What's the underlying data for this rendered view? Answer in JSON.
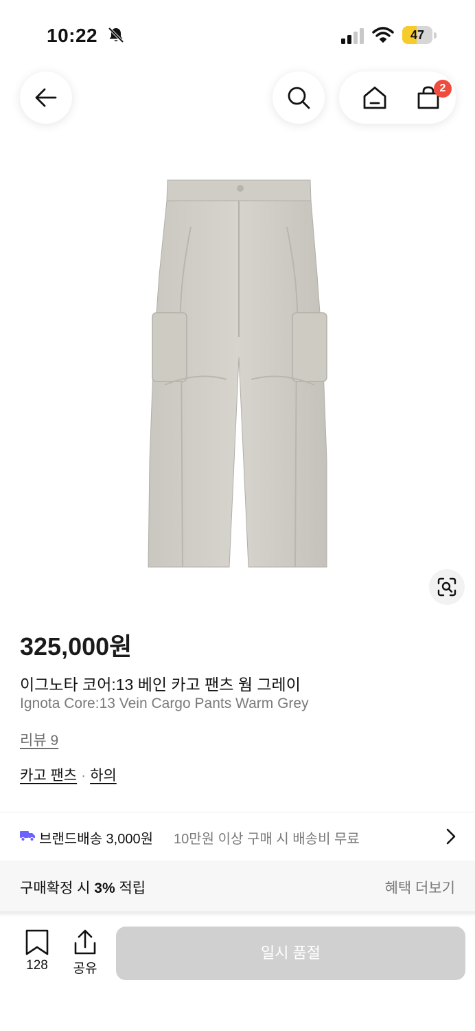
{
  "status_bar": {
    "time": "10:22",
    "battery": "47",
    "battery_level": 0.47,
    "icons": [
      "bell-slash-icon",
      "signal-icon",
      "wifi-icon",
      "battery-icon"
    ]
  },
  "nav": {
    "icons": [
      "back-arrow-icon",
      "search-icon",
      "home-icon",
      "shopping-bag-icon"
    ],
    "cart_badge": "2"
  },
  "product": {
    "image": "grey-cargo-pants",
    "price": "325,000원",
    "name_ko": "이그노타 코어:13 베인 카고 팬츠 웜 그레이",
    "name_en": "Ignota Core:13 Vein Cargo Pants Warm Grey",
    "review": "리뷰 9",
    "category_1": "카고 팬츠",
    "category_sep": "·",
    "category_2": "하의"
  },
  "shipping": {
    "main": "브랜드배송 3,000원",
    "sub": "10만원 이상 구매 시 배송비 무료"
  },
  "benefit": {
    "prefix": "구매확정 시 ",
    "highlight": "3%",
    "suffix": " 적립",
    "more": "혜택 더보기"
  },
  "bottom_bar": {
    "bookmark_count": "128",
    "share_label": "공유",
    "cta": "일시 품절"
  },
  "colors": {
    "accent_badge": "#ef4c3e",
    "truck": "#6b63ff",
    "battery_fill": "#f7cc2a",
    "disabled_button": "#d0d0d0"
  }
}
